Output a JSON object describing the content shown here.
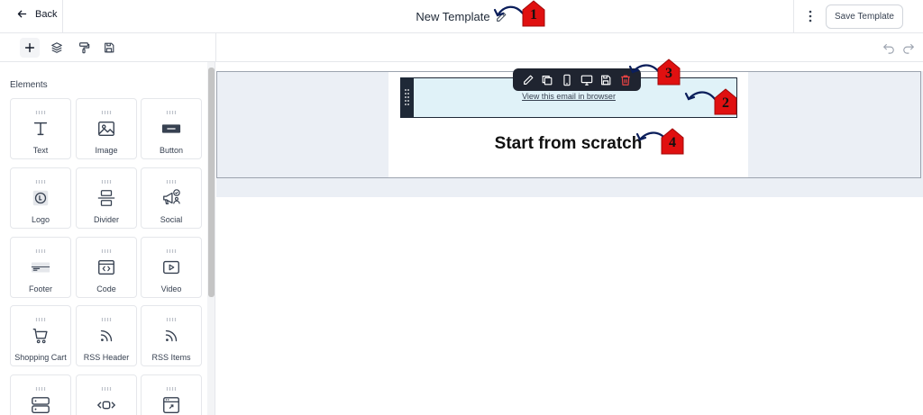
{
  "header": {
    "back_label": "Back",
    "title": "New Template",
    "save_label": "Save Template"
  },
  "sidebar": {
    "heading": "Elements",
    "elements": [
      {
        "label": "Text",
        "icon": "text-icon"
      },
      {
        "label": "Image",
        "icon": "image-icon"
      },
      {
        "label": "Button",
        "icon": "button-icon"
      },
      {
        "label": "Logo",
        "icon": "logo-icon"
      },
      {
        "label": "Divider",
        "icon": "divider-icon"
      },
      {
        "label": "Social",
        "icon": "social-icon"
      },
      {
        "label": "Footer",
        "icon": "footer-icon"
      },
      {
        "label": "Code",
        "icon": "code-icon"
      },
      {
        "label": "Video",
        "icon": "video-icon"
      },
      {
        "label": "Shopping Cart",
        "icon": "shopping-cart-icon"
      },
      {
        "label": "RSS Header",
        "icon": "rss-header-icon"
      },
      {
        "label": "RSS Items",
        "icon": "rss-items-icon"
      },
      {
        "label": "",
        "icon": "server-rows-icon"
      },
      {
        "label": "",
        "icon": "carousel-icon"
      },
      {
        "label": "",
        "icon": "browser-link-icon"
      }
    ]
  },
  "canvas": {
    "view_in_browser": "View this email in browser",
    "headline": "Start from scratch"
  },
  "annotations": [
    "1",
    "2",
    "3",
    "4"
  ],
  "colors": {
    "accent_dark": "#1f2430",
    "selected_block": "#e0f2f8",
    "canvas_bg": "#ebeff5",
    "marker_red": "#e01010",
    "arrow_navy": "#0b1e5b",
    "delete_red": "#ef4444"
  }
}
